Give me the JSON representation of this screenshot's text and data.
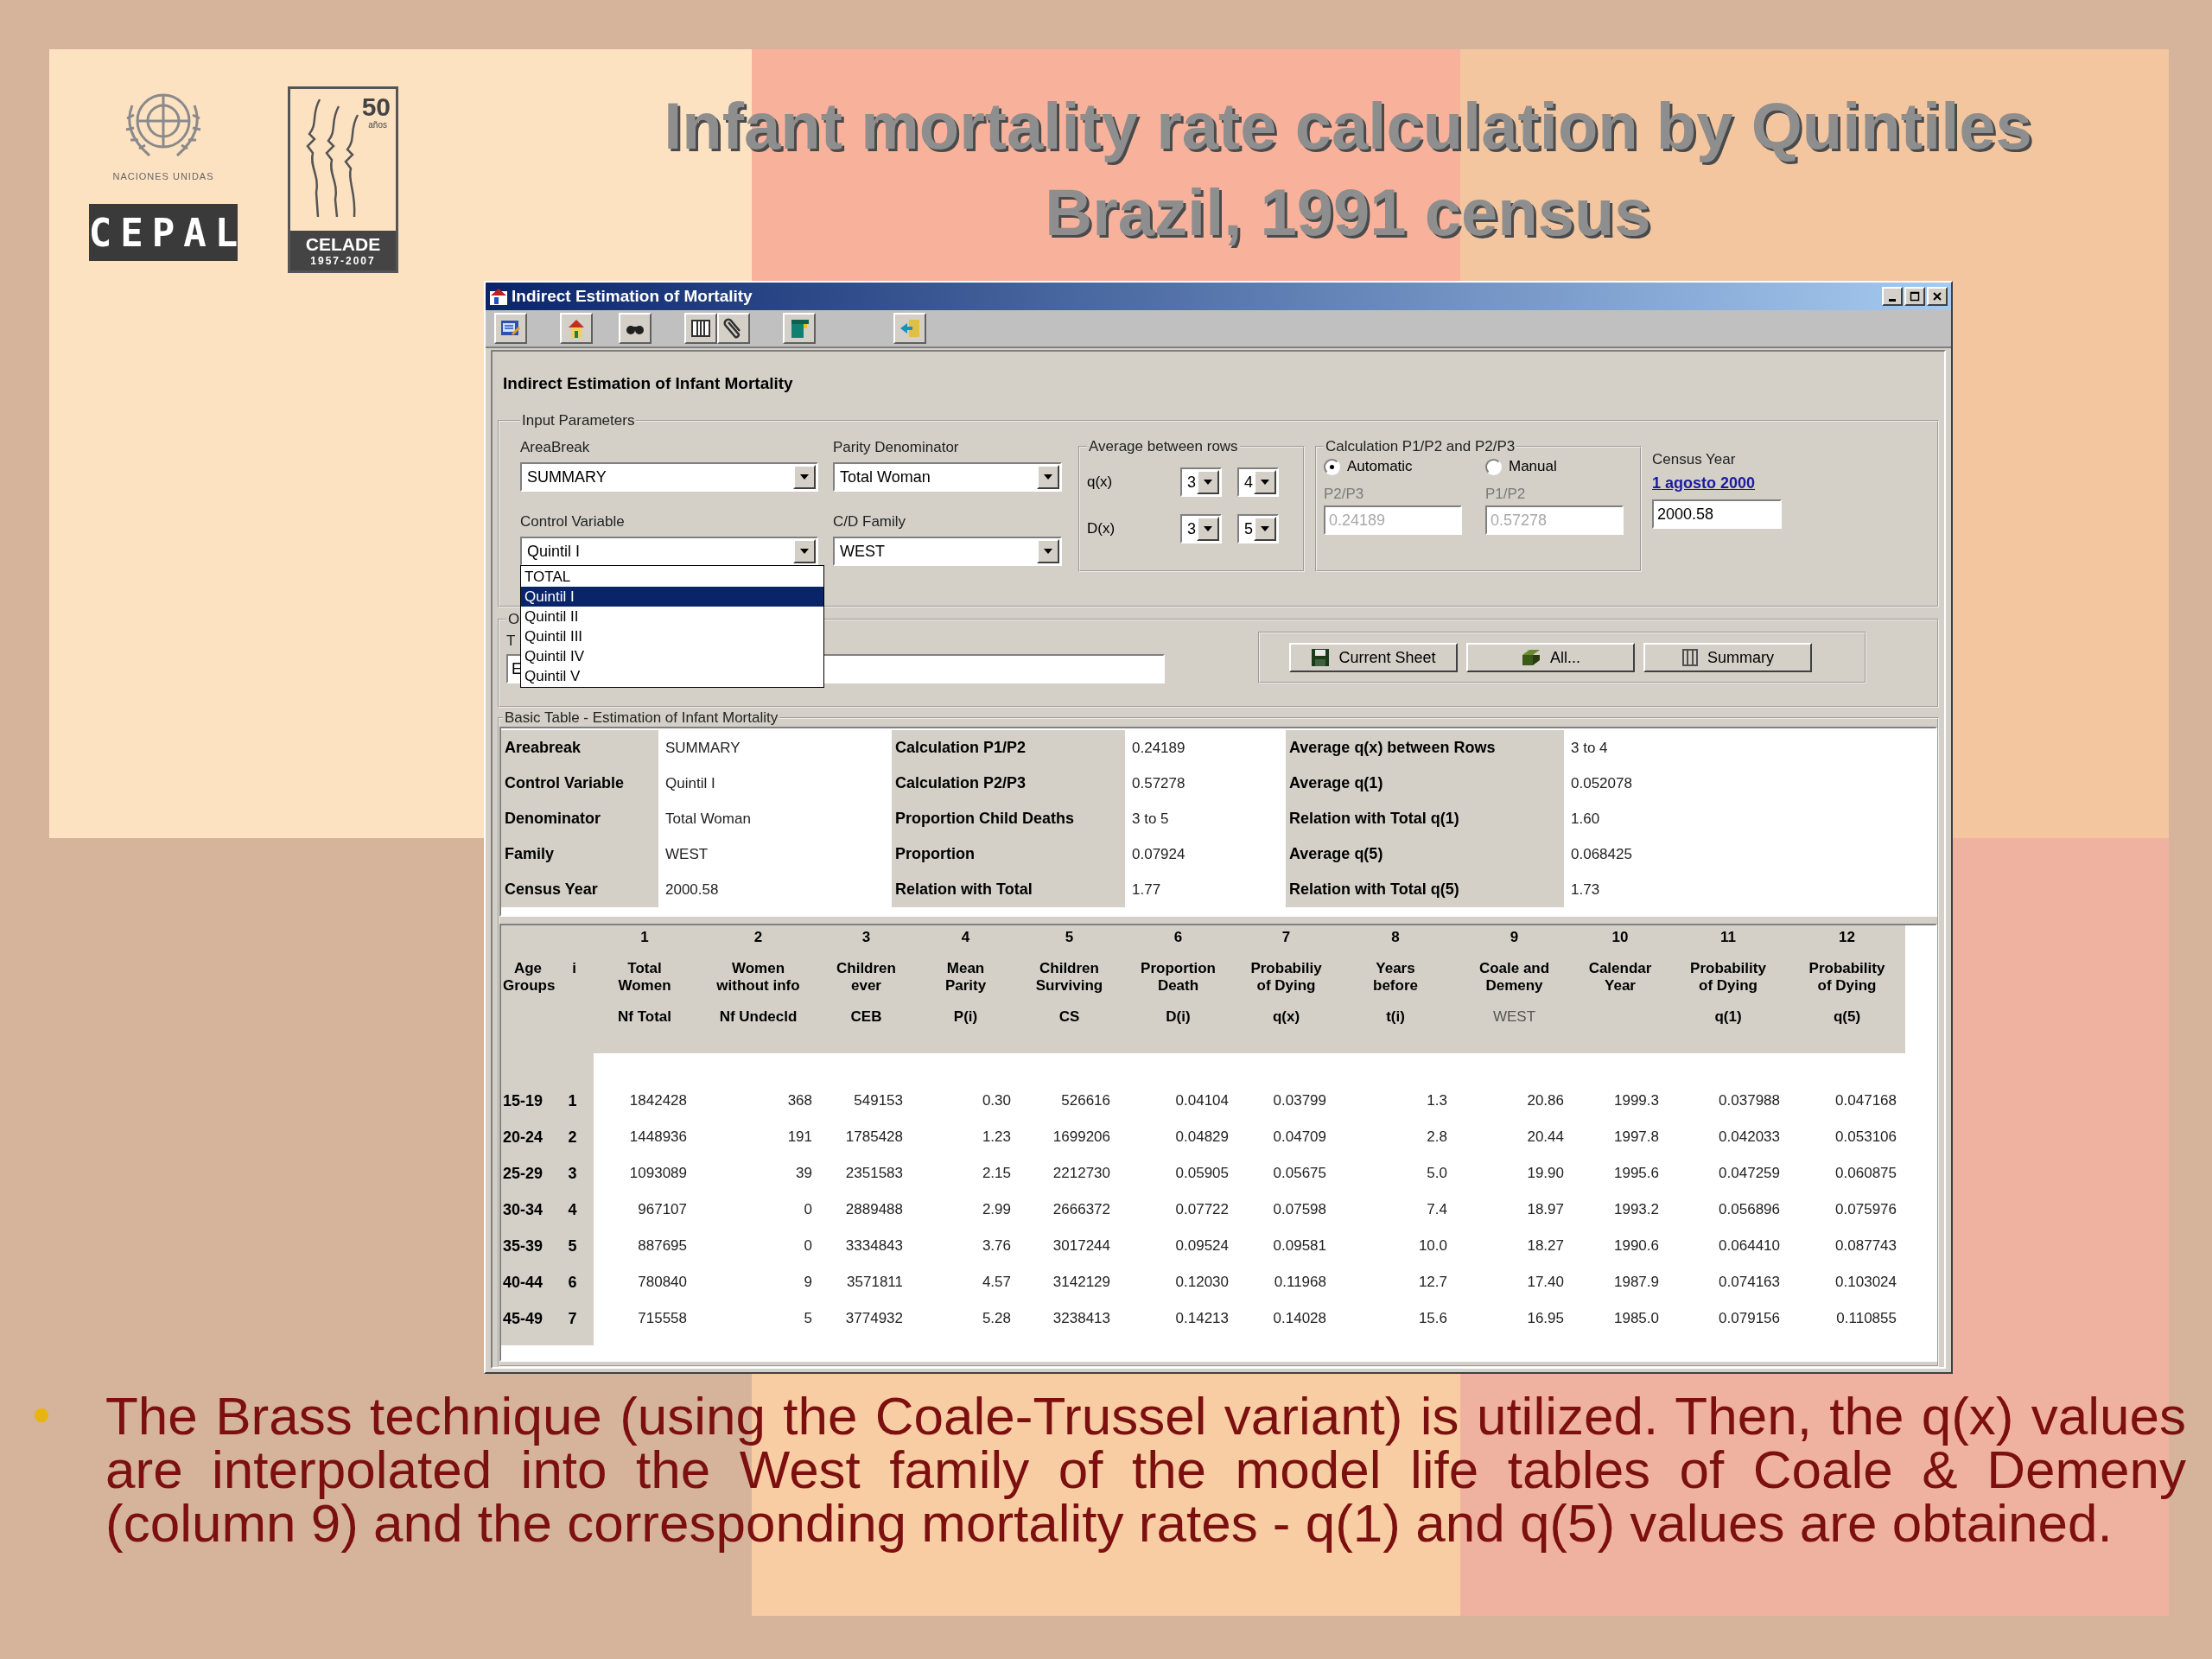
{
  "slide": {
    "title_lines": [
      "Infant mortality rate calculation by Quintiles",
      "Brazil, 1991 census"
    ],
    "un_logo": {
      "caption": "NACIONES UNIDAS",
      "block": "CEPAL"
    },
    "celade_logo": {
      "number": "50",
      "caption": "años",
      "name": "CELADE",
      "years": "1957-2007"
    },
    "bullet": "The Brass technique (using the Coale-Trussel variant) is utilized. Then, the q(x) values are interpolated into the West family of the model life tables of Coale & Demeny (column 9) and the corresponding mortality rates - q(1) and q(5) values are obtained."
  },
  "window": {
    "title": "Indirect Estimation of Mortality",
    "toolbar": [
      {
        "kind": "notebook"
      },
      {
        "kind": "house"
      },
      {
        "kind": "binoculars"
      },
      {
        "kind": "columns"
      },
      {
        "kind": "paperclip"
      },
      {
        "kind": "flag"
      },
      {
        "kind": "exit"
      }
    ]
  },
  "form": {
    "heading": "Indirect Estimation of Infant Mortality",
    "input_group": "Input Parameters",
    "areabreak": {
      "label": "AreaBreak",
      "value": "SUMMARY"
    },
    "parity": {
      "label": "Parity Denominator",
      "value": "Total Woman"
    },
    "control": {
      "label": "Control Variable",
      "value": "Quintil I",
      "expanded": true,
      "options": [
        {
          "label": "TOTAL",
          "selected": false
        },
        {
          "label": "Quintil I",
          "selected": true
        },
        {
          "label": "Quintil II",
          "selected": false
        },
        {
          "label": "Quintil III",
          "selected": false
        },
        {
          "label": "Quintil IV",
          "selected": false
        },
        {
          "label": "Quintil V",
          "selected": false
        }
      ]
    },
    "family": {
      "label": "C/D Family",
      "value": "WEST"
    },
    "average": {
      "title": "Average between rows",
      "rows": [
        {
          "label": "q(x)",
          "from": "3",
          "to": "4"
        },
        {
          "label": "D(x)",
          "from": "3",
          "to": "5"
        }
      ]
    },
    "calculation": {
      "title": "Calculation P1/P2 and P2/P3",
      "options": [
        {
          "label": "Automatic",
          "selected": true
        },
        {
          "label": "Manual",
          "selected": false
        }
      ],
      "fields": [
        {
          "label": "P2/P3",
          "value": "0.24189",
          "disabled": true
        },
        {
          "label": "P1/P2",
          "value": "0.57278",
          "disabled": true
        }
      ]
    },
    "census": {
      "label": "Census Year",
      "link": "1 agosto 2000",
      "value": "2000.58"
    },
    "output": {
      "title": "O",
      "label": "T",
      "value": "E"
    },
    "actions": [
      {
        "label": "Current Sheet",
        "kind": "save"
      },
      {
        "label": "All...",
        "kind": "all"
      },
      {
        "label": "Summary",
        "kind": "summary"
      }
    ],
    "basic_table_title": "Basic Table - Estimation of Infant Mortality"
  },
  "summary": [
    [
      {
        "label": "Areabreak",
        "value": "SUMMARY"
      },
      {
        "label": "Control Variable",
        "value": "Quintil I"
      },
      {
        "label": "Denominator",
        "value": "Total Woman"
      },
      {
        "label": "Family",
        "value": "WEST"
      },
      {
        "label": "Census Year",
        "value": "2000.58"
      }
    ],
    [
      {
        "label": "Calculation P1/P2",
        "value": "0.24189"
      },
      {
        "label": "Calculation P2/P3",
        "value": "0.57278"
      },
      {
        "label": "Proportion Child Deaths",
        "value": "3 to 5"
      },
      {
        "label": "Proportion",
        "value": "0.07924"
      },
      {
        "label": "Relation with Total",
        "value": "1.77"
      }
    ],
    [
      {
        "label": "Average q(x) between Rows",
        "value": "3 to 4"
      },
      {
        "label": "Average q(1)",
        "value": "0.052078"
      },
      {
        "label": "Relation with Total q(1)",
        "value": "1.60"
      },
      {
        "label": "Average q(5)",
        "value": "0.068425"
      },
      {
        "label": "Relation with Total q(5)",
        "value": "1.73"
      }
    ]
  ],
  "table": {
    "row_headers": [
      {
        "title_lines": [
          "Age",
          "Groups"
        ]
      },
      {
        "title_lines": [
          "i"
        ]
      }
    ],
    "columns": [
      {
        "number": "1",
        "title_lines": [
          "Total",
          "Women"
        ],
        "code": "Nf Total",
        "code_bold": true
      },
      {
        "number": "2",
        "title_lines": [
          "Women",
          "without info"
        ],
        "code": "Nf Undecld",
        "code_bold": true
      },
      {
        "number": "3",
        "title_lines": [
          "Children",
          "ever"
        ],
        "code": "CEB",
        "code_bold": true
      },
      {
        "number": "4",
        "title_lines": [
          "Mean",
          "Parity"
        ],
        "code": "P(i)",
        "code_bold": true
      },
      {
        "number": "5",
        "title_lines": [
          "Children",
          "Surviving"
        ],
        "code": "CS",
        "code_bold": true
      },
      {
        "number": "6",
        "title_lines": [
          "Proportion",
          "Death"
        ],
        "code": "D(i)",
        "code_bold": true
      },
      {
        "number": "7",
        "title_lines": [
          "Probabiliy",
          "of Dying"
        ],
        "code": "q(x)",
        "code_bold": true
      },
      {
        "number": "8",
        "title_lines": [
          "Years",
          "before"
        ],
        "code": "t(i)",
        "code_bold": true
      },
      {
        "number": "9",
        "title_lines": [
          "Coale and",
          "Demeny"
        ],
        "code": "WEST",
        "code_bold": false
      },
      {
        "number": "10",
        "title_lines": [
          "Calendar",
          "Year"
        ]
      },
      {
        "number": "11",
        "title_lines": [
          "Probability",
          "of Dying"
        ],
        "code": "q(1)",
        "code_bold": true
      },
      {
        "number": "12",
        "title_lines": [
          "Probability",
          "of Dying"
        ],
        "code": "q(5)",
        "code_bold": true
      }
    ],
    "rows": [
      {
        "age": "15-19",
        "i": "1",
        "values": [
          "1842428",
          "368",
          "549153",
          "0.30",
          "526616",
          "0.04104",
          "0.03799",
          "1.3",
          "20.86",
          "1999.3",
          "0.037988",
          "0.047168"
        ]
      },
      {
        "age": "20-24",
        "i": "2",
        "values": [
          "1448936",
          "191",
          "1785428",
          "1.23",
          "1699206",
          "0.04829",
          "0.04709",
          "2.8",
          "20.44",
          "1997.8",
          "0.042033",
          "0.053106"
        ]
      },
      {
        "age": "25-29",
        "i": "3",
        "values": [
          "1093089",
          "39",
          "2351583",
          "2.15",
          "2212730",
          "0.05905",
          "0.05675",
          "5.0",
          "19.90",
          "1995.6",
          "0.047259",
          "0.060875"
        ]
      },
      {
        "age": "30-34",
        "i": "4",
        "values": [
          "967107",
          "0",
          "2889488",
          "2.99",
          "2666372",
          "0.07722",
          "0.07598",
          "7.4",
          "18.97",
          "1993.2",
          "0.056896",
          "0.075976"
        ]
      },
      {
        "age": "35-39",
        "i": "5",
        "values": [
          "887695",
          "0",
          "3334843",
          "3.76",
          "3017244",
          "0.09524",
          "0.09581",
          "10.0",
          "18.27",
          "1990.6",
          "0.064410",
          "0.087743"
        ]
      },
      {
        "age": "40-44",
        "i": "6",
        "values": [
          "780840",
          "9",
          "3571811",
          "4.57",
          "3142129",
          "0.12030",
          "0.11968",
          "12.7",
          "17.40",
          "1987.9",
          "0.074163",
          "0.103024"
        ]
      },
      {
        "age": "45-49",
        "i": "7",
        "values": [
          "715558",
          "5",
          "3774932",
          "5.28",
          "3238413",
          "0.14213",
          "0.14028",
          "15.6",
          "16.95",
          "1985.0",
          "0.079156",
          "0.110855"
        ]
      }
    ]
  }
}
